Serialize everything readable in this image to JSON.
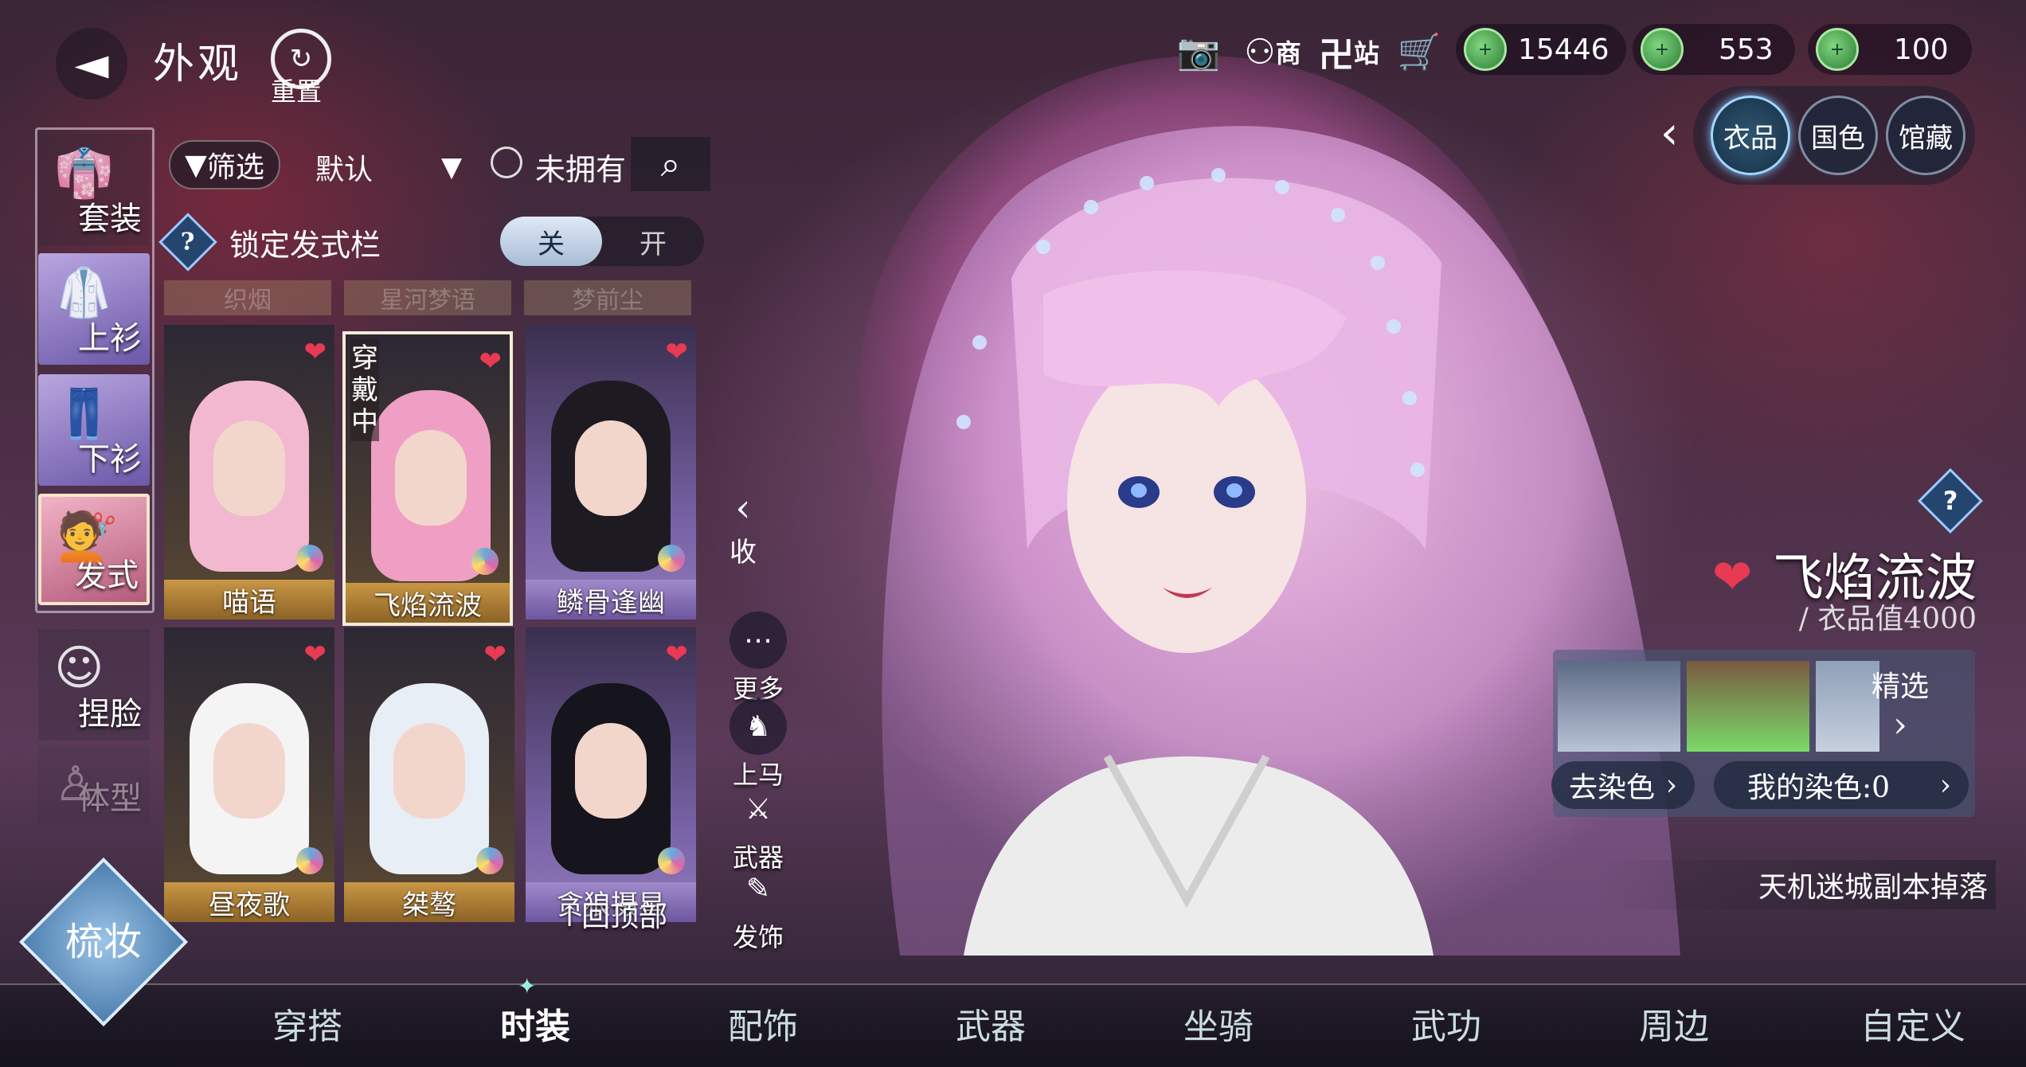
{
  "header": {
    "title": "外观",
    "reset_label": "重置"
  },
  "top_icons": {
    "camera": "camera-icon",
    "shop_label": "商",
    "station_label": "站",
    "cart": "cart-icon"
  },
  "currencies": [
    {
      "value": "15446",
      "icon": "jade-coin-icon",
      "color": "#4fb152"
    },
    {
      "value": "553",
      "icon": "jade-coin-icon",
      "color": "#4fb152"
    },
    {
      "value": "100",
      "icon": "jade-coin-icon",
      "color": "#4fb152"
    }
  ],
  "right_tabs": [
    "衣品",
    "国色",
    "馆藏"
  ],
  "categories": [
    "套装",
    "上衫",
    "下衫",
    "发式",
    "捏脸",
    "体型"
  ],
  "filter": {
    "filter_label": "筛选",
    "sort_label": "默认",
    "unowned_label": "未拥有"
  },
  "lock": {
    "label": "锁定发式栏",
    "off": "关",
    "on": "开"
  },
  "faded_tabs": [
    "织烟",
    "星河梦语",
    "梦前尘"
  ],
  "hair_cards": [
    {
      "name": "喵语"
    },
    {
      "name": "飞焰流波",
      "status": "穿戴中"
    },
    {
      "name": "鳞骨逢幽"
    },
    {
      "name": "昼夜歌"
    },
    {
      "name": "桀骜"
    },
    {
      "name": "贪狼摄星"
    }
  ],
  "back_to_top": "回顶部",
  "side_tools": {
    "collapse": "收",
    "more": "更多",
    "mount": "上马",
    "weapon": "武器",
    "hair_accessory": "发饰"
  },
  "item": {
    "name": "飞焰流波",
    "value": "/ 衣品值4000",
    "pick_label": "精选",
    "undye_label": "去染色",
    "my_dye_label": "我的染色:0",
    "source": "天机迷城副本掉落"
  },
  "makeup_label": "梳妆",
  "bottom_tabs": [
    "穿搭",
    "时装",
    "配饰",
    "武器",
    "坐骑",
    "武功",
    "周边",
    "自定义"
  ],
  "active_bottom_tab": "时装",
  "colors": {
    "gold_card": "#c99745",
    "lilac_card": "#a18acb",
    "heart": "#e83a52",
    "accent_blue": "#9fd8ff"
  }
}
